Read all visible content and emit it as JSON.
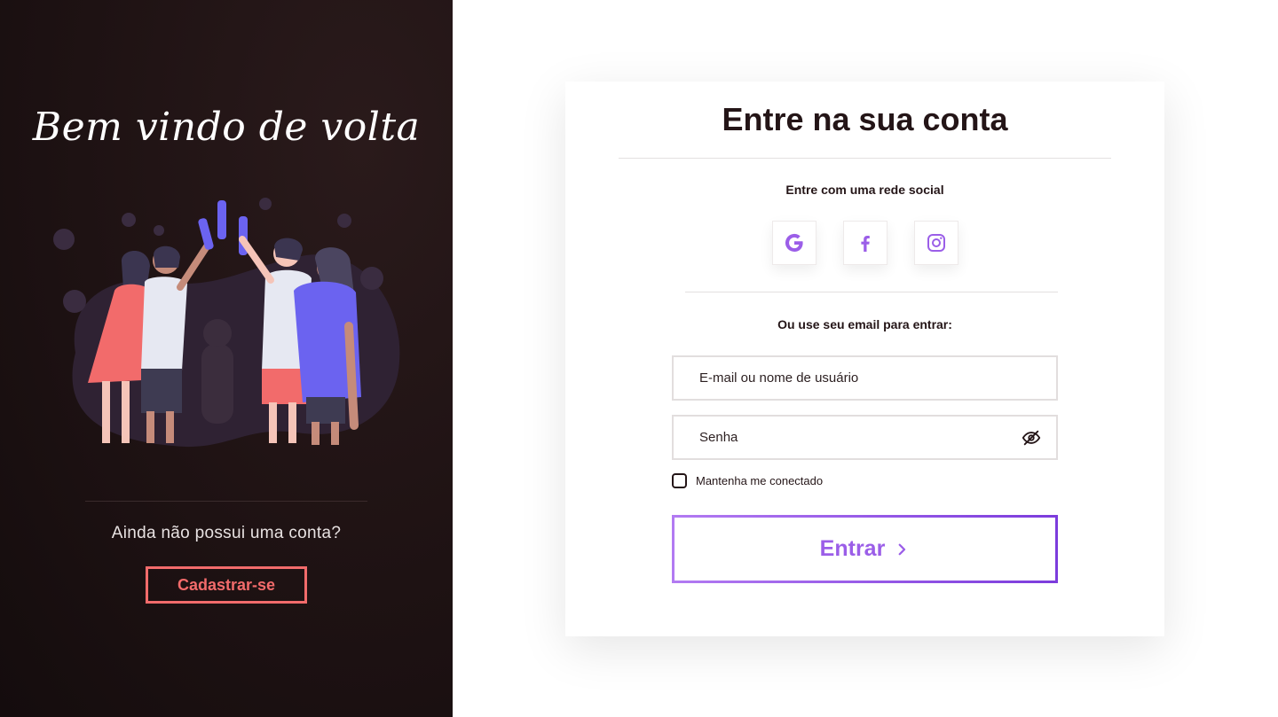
{
  "left_panel": {
    "welcome": "Bem vindo de volta",
    "no_account": "Ainda não possui uma conta?",
    "signup_label": "Cadastrar-se"
  },
  "card": {
    "title": "Entre na sua conta",
    "social_label": "Entre com uma rede social",
    "social": [
      {
        "name": "google",
        "icon": "google-icon"
      },
      {
        "name": "facebook",
        "icon": "facebook-icon"
      },
      {
        "name": "instagram",
        "icon": "instagram-icon"
      }
    ],
    "email_label": "Ou use seu email para entrar:",
    "email_placeholder": "E-mail ou nome de usuário",
    "password_placeholder": "Senha",
    "remember_label": "Mantenha me conectado",
    "login_label": "Entrar"
  },
  "colors": {
    "left_bg": "#1e1213",
    "accent_coral": "#f26b6b",
    "accent_purple": "#9b5ee8",
    "text_dark": "#241517"
  }
}
